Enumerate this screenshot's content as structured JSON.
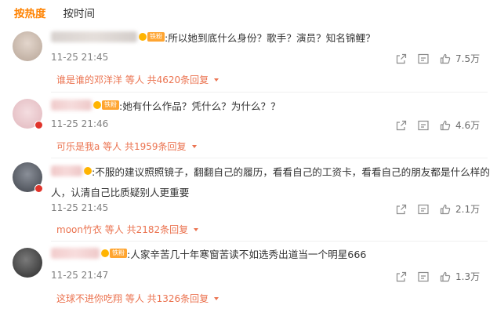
{
  "tabs": [
    {
      "label": "按热度",
      "active": true
    },
    {
      "label": "按时间",
      "active": false
    }
  ],
  "comments": [
    {
      "badge": "铁粉",
      "text": ":所以她到底什么身份？歌手？演员？知名锦鲤？",
      "text2": "",
      "time": "11-25 21:45",
      "likes": "7.5万",
      "replies": "谁是谁的邓洋洋 等人 共4620条回复"
    },
    {
      "badge": "铁粉",
      "text": ":她有什么作品？凭什么？为什么？？",
      "text2": "",
      "time": "11-25 21:46",
      "likes": "4.6万",
      "replies": "可乐是我a 等人 共1959条回复"
    },
    {
      "badge": "",
      "text": ":不服的建议照照镜子，翻翻自己的履历，看看自己的工资卡，看看自己的朋友都是什么样的",
      "text2": "人，认清自己比质疑别人更重要",
      "time": "11-25 21:45",
      "likes": "2.1万",
      "replies": "moon竹衣 等人 共2182条回复"
    },
    {
      "badge": "铁粉",
      "text": ":人家辛苦几十年寒窗苦读不如选秀出道当一个明星666",
      "text2": "",
      "time": "11-25 21:47",
      "likes": "1.3万",
      "replies": "这球不进你吃翔 等人 共1326条回复"
    }
  ],
  "colors": {
    "accent": "#ff8200",
    "reply": "#eb7350",
    "fan_badge": "#ffa531",
    "time": "#808080"
  }
}
